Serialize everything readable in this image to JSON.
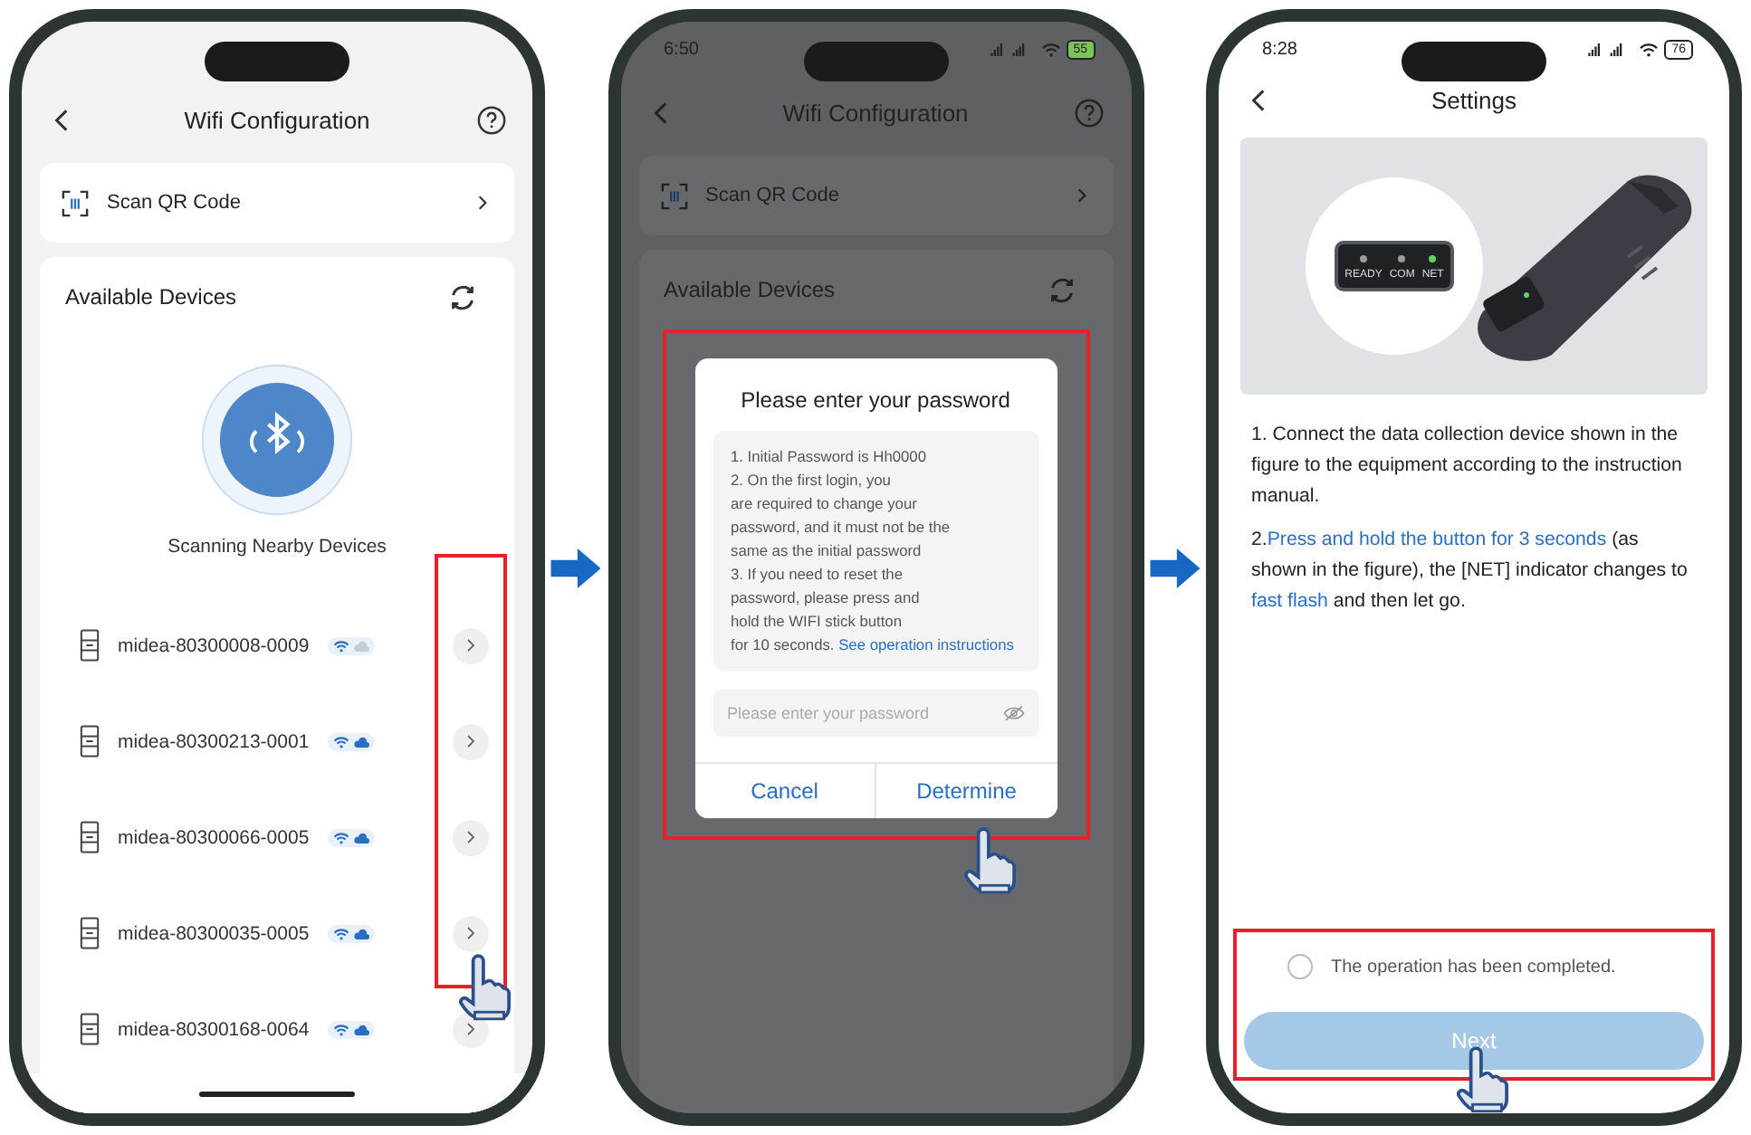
{
  "screen_1": {
    "title": "Wifi Configuration",
    "scan_row": {
      "label": "Scan QR Code"
    },
    "section_title": "Available Devices",
    "scan_status": "Scanning Nearby Devices",
    "devices": [
      {
        "name": "midea-80300008-0009",
        "wifi": true,
        "cloud": false
      },
      {
        "name": "midea-80300213-0001",
        "wifi": true,
        "cloud": true
      },
      {
        "name": "midea-80300066-0005",
        "wifi": true,
        "cloud": true
      },
      {
        "name": "midea-80300035-0005",
        "wifi": true,
        "cloud": true
      },
      {
        "name": "midea-80300168-0064",
        "wifi": true,
        "cloud": true
      }
    ]
  },
  "screen_2": {
    "status_time": "6:50",
    "battery": "55",
    "title": "Wifi Configuration",
    "scan_row": {
      "label": "Scan QR Code"
    },
    "section_title": "Available Devices",
    "dialog": {
      "title": "Please enter your password",
      "instructions": "1. Initial Password is Hh0000\n2. On the first login, you\nare required to change your\npassword, and it must not be the\nsame as the initial password\n3. If you need to reset the\npassword, please press and\nhold the WIFI stick button\nfor 10 seconds.",
      "link": "See operation instructions",
      "password": {
        "placeholder": "Please enter your password"
      },
      "buttons": [
        {
          "label": "Cancel"
        },
        {
          "label": "Determine"
        }
      ]
    }
  },
  "screen_3": {
    "status_time": "8:28",
    "battery": "76",
    "title": "Settings",
    "indicators": [
      {
        "label": "READY",
        "on": false
      },
      {
        "label": "COM",
        "on": false
      },
      {
        "label": "NET",
        "on": true
      }
    ],
    "steps": [
      [
        {
          "text": "1. Connect the data collection device shown in the figure to the equipment according to the instruction manual.",
          "highlight": false
        }
      ],
      [
        {
          "text": "2.",
          "highlight": false
        },
        {
          "text": "Press and hold the button for 3 seconds",
          "highlight": true
        },
        {
          "text": " (as shown in the figure), the [NET] indicator changes to ",
          "highlight": false
        },
        {
          "text": "fast flash",
          "highlight": true
        },
        {
          "text": " and then let go.",
          "highlight": false
        }
      ]
    ],
    "confirm": {
      "label": "The operation has been completed.",
      "checked": false
    },
    "next_button": {
      "label": "Next",
      "disabled": true
    }
  }
}
